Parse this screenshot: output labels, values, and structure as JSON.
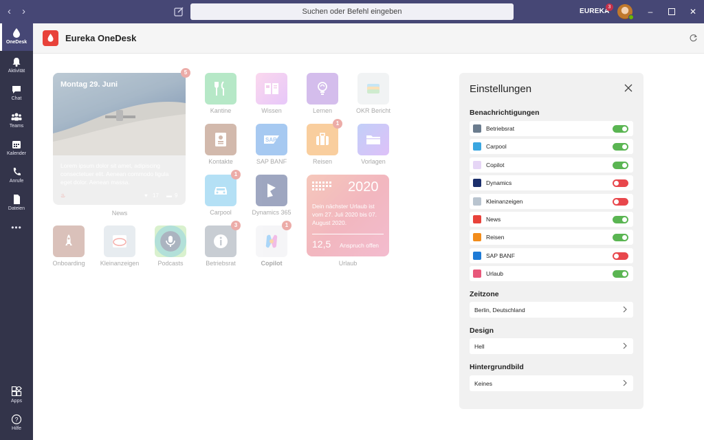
{
  "titlebar": {
    "search_placeholder": "Suchen oder Befehl eingeben",
    "org_name": "EUREKA",
    "org_badge": "3",
    "back_icon": "chevron-left-icon",
    "forward_icon": "chevron-right-icon"
  },
  "rail": {
    "items": [
      {
        "label": "OneDesk",
        "icon": "droplet-icon"
      },
      {
        "label": "Aktivität",
        "icon": "bell-icon"
      },
      {
        "label": "Chat",
        "icon": "chat-icon"
      },
      {
        "label": "Teams",
        "icon": "teams-icon"
      },
      {
        "label": "Kalender",
        "icon": "calendar-icon"
      },
      {
        "label": "Anrufe",
        "icon": "phone-icon"
      },
      {
        "label": "Dateien",
        "icon": "file-icon"
      },
      {
        "label": "Apps",
        "icon": "apps-icon"
      },
      {
        "label": "Hilfe",
        "icon": "help-icon"
      }
    ],
    "more": "•••"
  },
  "app": {
    "title": "Eureka OneDesk"
  },
  "tiles": {
    "news": {
      "date": "Montag 29. Juni",
      "body": "Lorem ipsum dolor sit amet, adipiscing consectetuer elit. Aenean commodo ligula eget dolor. Aenean massa.",
      "likes": "17",
      "comments": "9",
      "badge": "5",
      "label": "News"
    },
    "apps": [
      {
        "label": "Kantine",
        "color": "#54c97c"
      },
      {
        "label": "Wissen",
        "color": "#f08ad8"
      },
      {
        "label": "Lernen",
        "color": "#9b64d4"
      },
      {
        "label": "OKR Bericht",
        "color": "#dfe3e6"
      },
      {
        "label": "Kontakte",
        "color": "#955a3c"
      },
      {
        "label": "SAP BANF",
        "color": "#2e7fde"
      },
      {
        "label": "Reisen",
        "color": "#f28c1b",
        "badge": "1"
      },
      {
        "label": "Vorlagen",
        "color": "#8c6fe6"
      },
      {
        "label": "Carpool",
        "color": "#4fb6e8",
        "badge": "1"
      },
      {
        "label": "Dynamics 365",
        "color": "#1b2e6b"
      },
      {
        "label": "Onboarding",
        "color": "#a86e5c"
      },
      {
        "label": "Kleinanzeigen",
        "color": "#c8d3dd"
      },
      {
        "label": "Podcasts",
        "color": "#49b6a6"
      },
      {
        "label": "Betriebsrat",
        "color": "#7d8a99",
        "badge": "3"
      },
      {
        "label": "Copilot",
        "color": "#e9e9ee",
        "badge": "1"
      }
    ],
    "urlaub": {
      "year": "2020",
      "text": "Dein nächster Urlaub ist vom 27. Juli 2020 bis 07. August 2020.",
      "days": "12,5",
      "claim": "Anspruch offen",
      "label": "Urlaub"
    }
  },
  "settings": {
    "title": "Einstellungen",
    "notifications_title": "Benachrichtigungen",
    "notifications": [
      {
        "label": "Betriebsrat",
        "on": true,
        "color": "#6b7c8e"
      },
      {
        "label": "Carpool",
        "on": true,
        "color": "#3aa6e0"
      },
      {
        "label": "Copilot",
        "on": true,
        "color": "#e6d6f6"
      },
      {
        "label": "Dynamics",
        "on": false,
        "color": "#1b2e6b"
      },
      {
        "label": "Kleinanzeigen",
        "on": false,
        "color": "#b9c4cf"
      },
      {
        "label": "News",
        "on": true,
        "color": "#e8423a"
      },
      {
        "label": "Reisen",
        "on": true,
        "color": "#f28c1b"
      },
      {
        "label": "SAP BANF",
        "on": false,
        "color": "#1d7ad6"
      },
      {
        "label": "Urlaub",
        "on": true,
        "color": "#e8587a"
      }
    ],
    "timezone_title": "Zeitzone",
    "timezone_value": "Berlin, Deutschland",
    "design_title": "Design",
    "design_value": "Hell",
    "background_title": "Hintergrundbild",
    "background_value": "Keines"
  }
}
